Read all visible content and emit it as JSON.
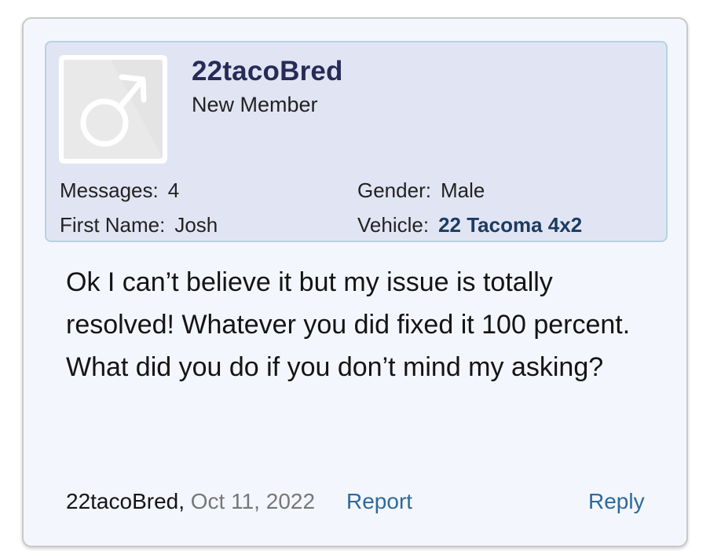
{
  "user": {
    "username": "22tacoBred",
    "title": "New Member",
    "avatar_icon": "male-symbol-icon",
    "stats": {
      "messages_label": "Messages:",
      "messages_value": "4",
      "first_name_label": "First Name:",
      "first_name_value": "Josh",
      "gender_label": "Gender:",
      "gender_value": "Male",
      "vehicle_label": "Vehicle:",
      "vehicle_value": "22 Tacoma 4x2"
    }
  },
  "message": {
    "body": "Ok I can’t believe it but my issue is totally resolved! Whatever you did fixed it 100 percent. What did you do if you don’t mind my asking?"
  },
  "footer": {
    "author": "22tacoBred,",
    "date": "Oct 11, 2022",
    "report_label": "Report",
    "reply_label": "Reply"
  },
  "colors": {
    "username": "#262b58",
    "link": "#2d6a9a",
    "user_block_bg": "#e1e5f3",
    "card_bg": "#f4f6fd"
  }
}
